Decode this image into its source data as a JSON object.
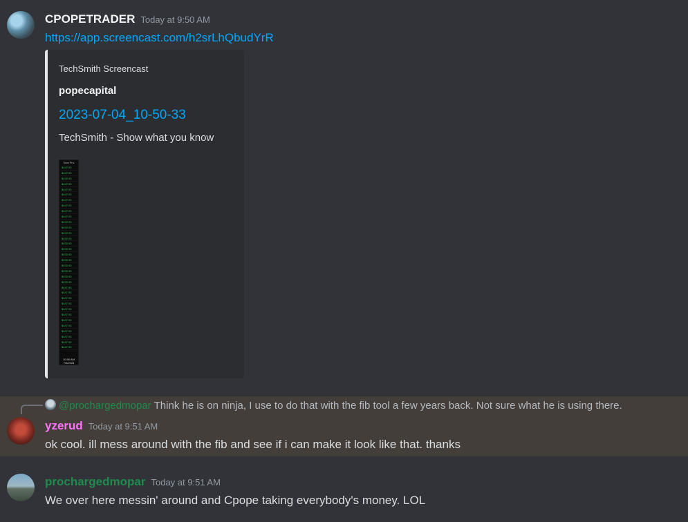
{
  "messages": [
    {
      "username": "CPOPETRADER",
      "username_color": "#f2f3f5",
      "timestamp": "Today at 9:50 AM",
      "link": "https://app.screencast.com/h2srLhQbudYrR",
      "embed": {
        "provider": "TechSmith Screencast",
        "author": "popecapital",
        "title": "2023-07-04_10-50-33",
        "description": "TechSmith - Show what you know",
        "thumbnail": {
          "header": "Total PnL",
          "rows": [
            "$447.93",
            "$447.93",
            "$432.93",
            "$447.93",
            "$447.93",
            "$447.93",
            "$447.93",
            "$447.93",
            "$447.93",
            "$447.93",
            "$432.93",
            "$432.93",
            "$432.93",
            "$432.93",
            "$432.93",
            "$432.93",
            "$432.93",
            "$432.93",
            "$432.93",
            "$432.93",
            "$432.93",
            "$432.93",
            "$447.93",
            "$447.93",
            "$447.93",
            "$447.93",
            "$447.93",
            "$447.93",
            "$447.93",
            "$447.93",
            "$447.93",
            "$447.93",
            "$447.93",
            "$447.93"
          ],
          "footer_time": "10:50 AM",
          "footer_date": "7/4/2023"
        }
      }
    },
    {
      "reply_to": {
        "username": "@prochargedmopar",
        "text": "Think he is on ninja, I use to do that with the fib tool a few years back. Not sure what he is using there."
      },
      "username": "yzerud",
      "username_color": "#ff73fa",
      "timestamp": "Today at 9:51 AM",
      "text": "ok cool. ill mess around with the fib and see if i can make it look like that. thanks"
    },
    {
      "username": "prochargedmopar",
      "username_color": "#1f8b4c",
      "timestamp": "Today at 9:51 AM",
      "text": "We over here messin' around and Cpope taking everybody's money.  LOL"
    }
  ]
}
